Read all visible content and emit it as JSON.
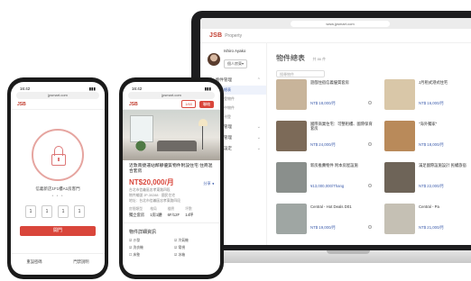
{
  "laptop": {
    "url": "www.jpsmart.com",
    "brand": "JSB",
    "brand_sub": "Property",
    "user": {
      "name": "Ishiro Ayako",
      "role": "個人房東▾"
    },
    "nav": [
      {
        "label": "物件管理",
        "chev": "⌃",
        "subs": [
          {
            "label": "物件總表",
            "active": true
          },
          {
            "label": "未刊登物件",
            "active": false
          },
          {
            "label": "刊登中物件",
            "active": false
          },
          {
            "label": "暫停刊登",
            "active": false
          }
        ]
      },
      {
        "label": "合約管理",
        "chev": "⌄",
        "subs": []
      },
      {
        "label": "帳務管理",
        "chev": "⌄",
        "subs": []
      },
      {
        "label": "系統設定",
        "chev": "⌄",
        "subs": []
      }
    ],
    "page_title": "物件總表",
    "page_count": "共 86 件",
    "search_placeholder": "搜尋物件",
    "cards": [
      {
        "title": "遊戲住宿信義優質套房",
        "price": "NT$ 18,000/月",
        "color": "#c8b49a"
      },
      {
        "title": "J月租式港式住宅",
        "price": "NT$ 16,000/月",
        "color": "#d9c7a8"
      },
      {
        "title": "國際商業住宅：可整租樓、國際保育套房",
        "price": "NT$ 24,000/月",
        "color": "#7c6a58"
      },
      {
        "title": "\"海外獨家\"",
        "price": "NT$ 18,000/月",
        "color": "#b98a5a"
      },
      {
        "title": "新房推薦物件 附本房屋設施",
        "price": "¥13,000,000/Thang",
        "color": "#8a8f8c"
      },
      {
        "title": "滿足國際設施設計 民權旅宿",
        "price": "NT$ 22,000/月",
        "color": "#6e6458"
      },
      {
        "title": "Central - Hot Deals D01",
        "price": "NT$ 19,000/月",
        "color": "#9fa6a3"
      },
      {
        "title": "Central - Pa",
        "price": "NT$ 21,000/月",
        "color": "#c5c0b4"
      }
    ]
  },
  "phone_left": {
    "time": "16:42",
    "url": "jpsmart.com",
    "brand": "JSB",
    "room_text": "信義新店1F1樓A1房客門",
    "pager": "• • •",
    "pins": [
      "1",
      "1",
      "1",
      "1"
    ],
    "open_button": "開門",
    "links": [
      "重設密碼",
      "門禁說明"
    ]
  },
  "phone_center": {
    "time": "16:42",
    "url": "jpsmart.com",
    "brand": "JSB",
    "tool_ghost": "1/60",
    "tool_solid": "聯絡",
    "title": "近敦南捷運站鄰靜優質物件附設住宅 住商混合套房",
    "price": "NT$20,000/月",
    "share": "分享 ◂",
    "meta": [
      "台北市信義區忠孝東路四段",
      "物件編號 JP-30288 · 國民住宅",
      "地址：台北市信義區忠孝東路四段"
    ],
    "stats": [
      {
        "k": "房間類型",
        "v": "獨立套房"
      },
      {
        "k": "格局",
        "v": "1房1廳"
      },
      {
        "k": "樓層",
        "v": "6F/12F"
      },
      {
        "k": "坪數",
        "v": "14坪"
      }
    ],
    "section": "物件詳細資訊",
    "features": [
      "☑ 沙發",
      "☑ 冷氣機",
      "☑ 洗衣機",
      "☑ 電視",
      "☐ 床墊",
      "☑ 冰箱"
    ]
  }
}
